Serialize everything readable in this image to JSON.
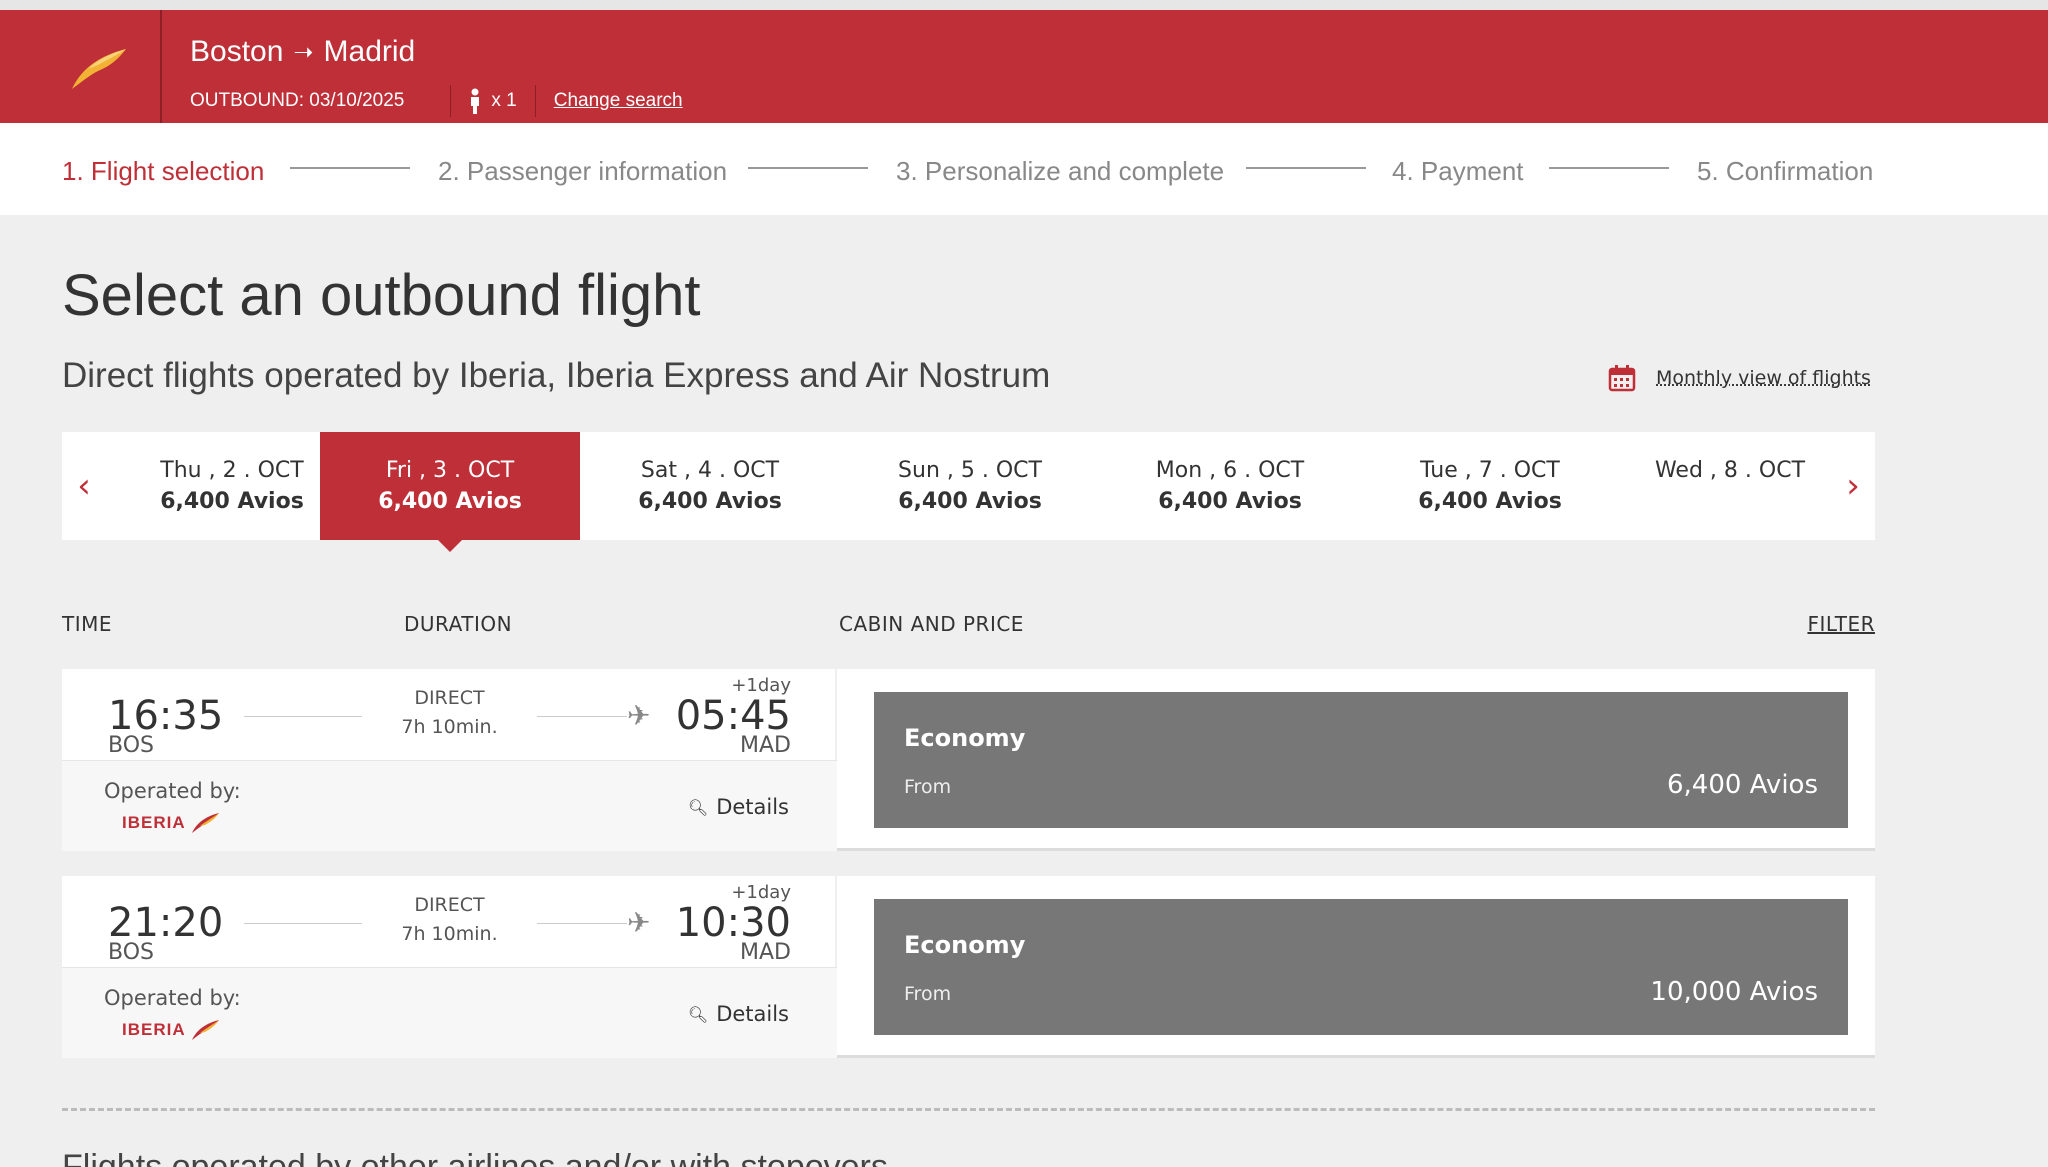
{
  "header": {
    "origin": "Boston",
    "destination": "Madrid",
    "outbound_label": "OUTBOUND:",
    "outbound_date": "03/10/2025",
    "passengers": "x 1",
    "change_search": "Change search",
    "brand_color": "#bf2f38"
  },
  "steps": [
    {
      "label": "1. Flight selection",
      "active": true
    },
    {
      "label": "2. Passenger information",
      "active": false
    },
    {
      "label": "3. Personalize and complete",
      "active": false
    },
    {
      "label": "4. Payment",
      "active": false
    },
    {
      "label": "5. Confirmation",
      "active": false
    }
  ],
  "page": {
    "title": "Select an outbound flight",
    "subtitle": "Direct flights operated by Iberia, Iberia Express and Air Nostrum",
    "monthly_view": "Monthly view of flights",
    "bottom_partial": "Flights operated by other airlines and/or with stopovers"
  },
  "dates": [
    {
      "day": "Thu , 2 . OCT",
      "price": "6,400 Avios",
      "selected": false
    },
    {
      "day": "Fri , 3 . OCT",
      "price": "6,400 Avios",
      "selected": true
    },
    {
      "day": "Sat , 4 . OCT",
      "price": "6,400 Avios",
      "selected": false
    },
    {
      "day": "Sun , 5 . OCT",
      "price": "6,400 Avios",
      "selected": false
    },
    {
      "day": "Mon , 6 . OCT",
      "price": "6,400 Avios",
      "selected": false
    },
    {
      "day": "Tue , 7 . OCT",
      "price": "6,400 Avios",
      "selected": false
    },
    {
      "day": "Wed , 8 . OCT",
      "price": "",
      "selected": false
    }
  ],
  "columns": {
    "time": "TIME",
    "duration": "DURATION",
    "cabin_price": "CABIN AND PRICE",
    "filter": "FILTER"
  },
  "flights": [
    {
      "dep_time": "16:35",
      "dep_code": "BOS",
      "arr_time": "05:45",
      "arr_code": "MAD",
      "plus_day": "+1day",
      "type": "DIRECT",
      "duration": "7h 10min.",
      "operated_by": "Operated by:",
      "airline": "IBERIA",
      "details": "Details",
      "cabin": "Economy",
      "from": "From",
      "price": "6,400 Avios"
    },
    {
      "dep_time": "21:20",
      "dep_code": "BOS",
      "arr_time": "10:30",
      "arr_code": "MAD",
      "plus_day": "+1day",
      "type": "DIRECT",
      "duration": "7h 10min.",
      "operated_by": "Operated by:",
      "airline": "IBERIA",
      "details": "Details",
      "cabin": "Economy",
      "from": "From",
      "price": "10,000 Avios"
    }
  ]
}
